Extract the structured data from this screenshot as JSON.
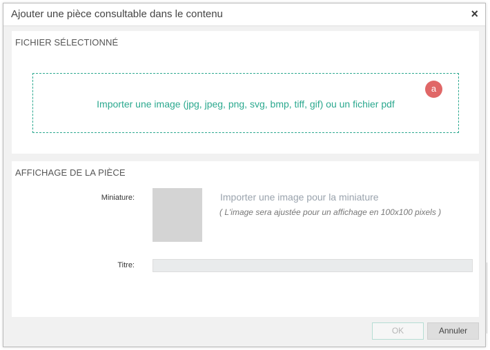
{
  "dialog": {
    "title": "Ajouter une pièce consultable dans le contenu",
    "close_symbol": "×"
  },
  "selected_file": {
    "heading": "FICHIER SÉLECTIONNÉ",
    "dropzone_text": "Importer une image (jpg, jpeg, png, svg, bmp, tiff, gif) ou un fichier pdf",
    "badge": "a"
  },
  "display": {
    "heading": "AFFICHAGE DE LA PIÈCE",
    "thumbnail_label": "Miniature:",
    "import_thumbnail": "Importer une image pour la miniature",
    "thumbnail_hint": "( L'image sera ajustée pour un affichage en 100x100 pixels )",
    "title_label": "Titre:",
    "title_value": ""
  },
  "footer": {
    "ok_label": "OK",
    "cancel_label": "Annuler"
  },
  "colors": {
    "accent": "#2aa88e",
    "badge": "#e06767"
  }
}
